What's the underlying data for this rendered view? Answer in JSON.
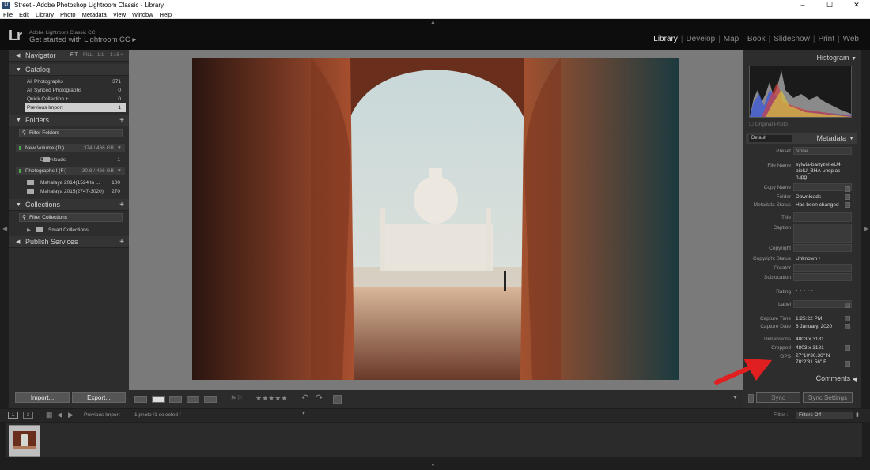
{
  "window": {
    "title": "Street - Adobe Photoshop Lightroom Classic - Library",
    "app_icon": "Lr",
    "controls": [
      "–",
      "☐",
      "✕"
    ]
  },
  "menu": [
    "File",
    "Edit",
    "Library",
    "Photo",
    "Metadata",
    "View",
    "Window",
    "Help"
  ],
  "identity": {
    "logo": "Lr",
    "line1": "Adobe Lightroom Classic CC",
    "line2": "Get started with Lightroom CC ▸"
  },
  "modules": [
    {
      "label": "Library",
      "active": true
    },
    {
      "label": "Develop"
    },
    {
      "label": "Map"
    },
    {
      "label": "Book"
    },
    {
      "label": "Slideshow"
    },
    {
      "label": "Print"
    },
    {
      "label": "Web"
    }
  ],
  "navigator": {
    "title": "Navigator",
    "zoom": [
      "FIT",
      "FILL",
      "1:1",
      "1:16 ÷"
    ]
  },
  "catalog": {
    "title": "Catalog",
    "items": [
      {
        "label": "All Photographs",
        "count": "371"
      },
      {
        "label": "All Synced Photographs",
        "count": "0"
      },
      {
        "label": "Quick Collection +",
        "count": "0"
      },
      {
        "label": "Previous Import",
        "count": "1",
        "selected": true
      }
    ]
  },
  "folders": {
    "title": "Folders",
    "filter": "Filter Folders",
    "volumes": [
      {
        "label": "New Volume (D:)",
        "size": "374 / 466 GB"
      },
      {
        "label": "Photographs I (F:)",
        "size": "30.8 / 466 GB"
      }
    ],
    "items": [
      {
        "label": "Downloads",
        "count": "1"
      },
      {
        "label": "Mahalaya 2014(1524 to ...",
        "count": "100"
      },
      {
        "label": "Mahalaya 2015(2747-3020)",
        "count": "270"
      }
    ]
  },
  "collections": {
    "title": "Collections",
    "filter": "Filter Collections",
    "smart": "Smart Collections"
  },
  "publish": {
    "title": "Publish Services"
  },
  "left_buttons": {
    "import": "Import...",
    "export": "Export..."
  },
  "histogram": {
    "title": "Histogram",
    "original": "Original Photo"
  },
  "metadata": {
    "title": "Metadata",
    "preset_dropdown": "Default",
    "preset_label": "Preset",
    "preset_value": "None",
    "fields": [
      {
        "label": "File Name",
        "value": "sylwia-bartyzel-eU4piplU_BHA-unsplash.jpg"
      },
      {
        "label": "Copy Name",
        "value": ""
      },
      {
        "label": "Folder",
        "value": "Downloads"
      },
      {
        "label": "Metadata Status",
        "value": "Has been changed"
      },
      {
        "label": "Title",
        "value": ""
      },
      {
        "label": "Caption",
        "value": ""
      },
      {
        "label": "Copyright",
        "value": ""
      },
      {
        "label": "Copyright Status",
        "value": "Unknown ÷"
      },
      {
        "label": "Creator",
        "value": ""
      },
      {
        "label": "Sublocation",
        "value": ""
      },
      {
        "label": "Rating",
        "value": "·  ·  ·  ·  ·"
      },
      {
        "label": "Label",
        "value": ""
      },
      {
        "label": "Capture Time",
        "value": "1:25:22 PM"
      },
      {
        "label": "Capture Date",
        "value": "6 January, 2020"
      },
      {
        "label": "Dimensions",
        "value": "4803 x 3181"
      },
      {
        "label": "Cropped",
        "value": "4803 x 3181"
      },
      {
        "label": "GPS",
        "value": "27°10'30.36\" N 78°2'31.56\" E"
      }
    ]
  },
  "comments": {
    "title": "Comments"
  },
  "right_buttons": {
    "sync": "Sync",
    "sync_settings": "Sync Settings"
  },
  "toolbar": {
    "rating": "★★★★★"
  },
  "filmstrip": {
    "pages": [
      "1",
      "2"
    ],
    "source": "Previous Import",
    "count": "1 photo /1 selected /",
    "filter_label": "Filter :",
    "filter_value": "Filters Off"
  },
  "colors": {
    "accent": "#e02020",
    "panel": "#2d2d2d",
    "selected": "#cfcfcf"
  }
}
